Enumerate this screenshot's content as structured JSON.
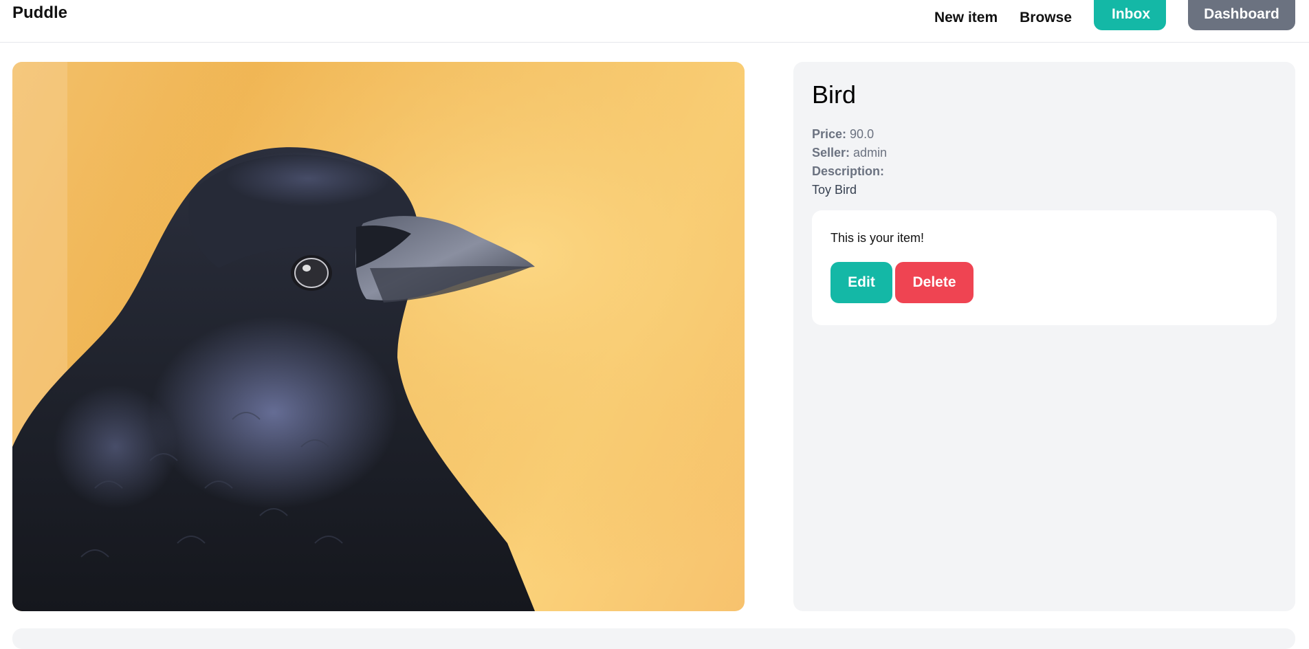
{
  "navbar": {
    "brand": "Puddle",
    "new_item": "New item",
    "browse": "Browse",
    "inbox": "Inbox",
    "dashboard": "Dashboard"
  },
  "item": {
    "title": "Bird",
    "price_label": "Price:",
    "price_value": "90.0",
    "seller_label": "Seller:",
    "seller_value": "admin",
    "description_label": "Description:",
    "description_value": "Toy Bird"
  },
  "owner_panel": {
    "message": "This is your item!",
    "edit_label": "Edit",
    "delete_label": "Delete"
  },
  "colors": {
    "accent": "#14b8a6",
    "danger": "#ef4452",
    "neutral_button": "#6b7280",
    "panel_bg": "#f3f4f6"
  }
}
